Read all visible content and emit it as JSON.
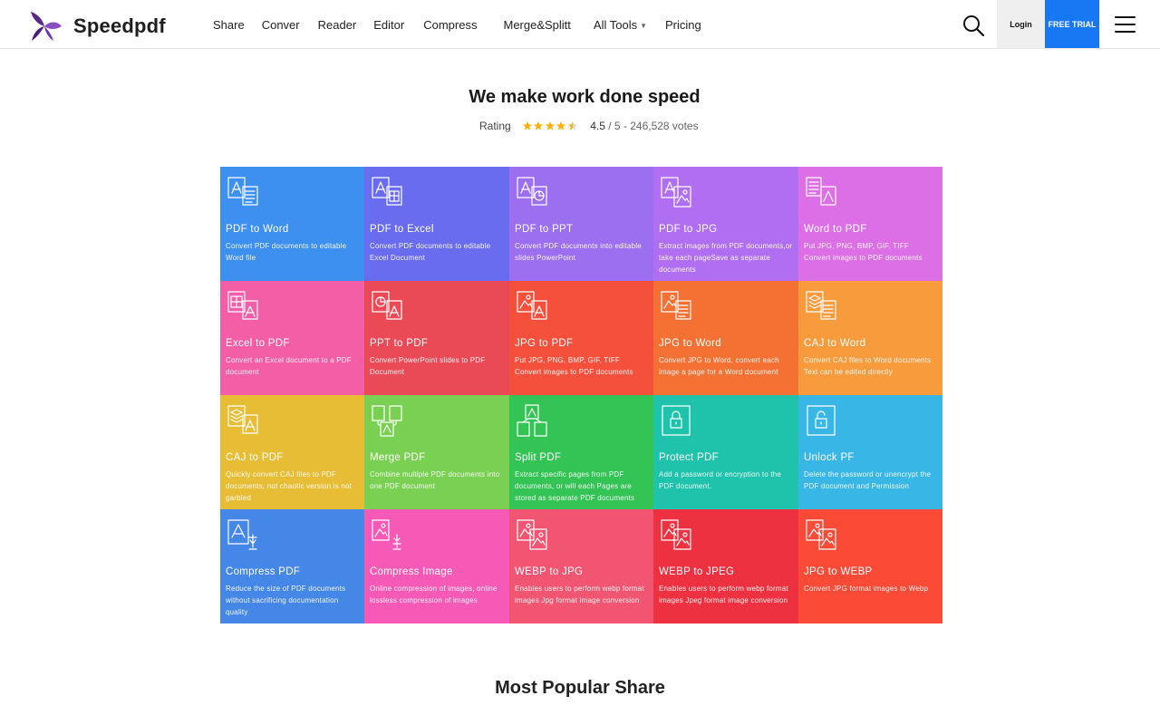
{
  "brand": {
    "name": "Speedpdf"
  },
  "nav": {
    "items": [
      "Share",
      "Conver",
      "Reader",
      "Editor",
      "Compress",
      "Merge&Splitt",
      "All Tools",
      "Pricing"
    ]
  },
  "header": {
    "login_label": "Login",
    "trial_label": "FREE TRIAL"
  },
  "hero": {
    "title": "We make work done speed",
    "rating_label": "Rating",
    "rating_score": "4.5",
    "rating_rest": " / 5 - 246,528 votes",
    "stars": 4.5
  },
  "tools": [
    {
      "title": "PDF to Word",
      "desc": "Convert PDF documents to editable Word file",
      "color": "#3d8ff0"
    },
    {
      "title": "PDF to Excel",
      "desc": "Convert PDF documents to editable Excel Document",
      "color": "#6a6cf0"
    },
    {
      "title": "PDF to PPT",
      "desc": "Convert PDF documents into editable slides PowerPoint",
      "color": "#9c6ff0"
    },
    {
      "title": "PDF to JPG",
      "desc": "Extract images from PDF documents,or take each pageSave as separate  documents",
      "color": "#b06ef2"
    },
    {
      "title": "Word to PDF",
      "desc": "Put JPG, PNG, BMP, GIF, TIFF Convert images to PDF documents",
      "color": "#dc6ee6"
    },
    {
      "title": "Excel to PDF",
      "desc": "Convert an Excel document to a PDF document",
      "color": "#f35ea6"
    },
    {
      "title": "PPT to PDF",
      "desc": "Convert PowerPoint slides to PDF Document",
      "color": "#ea4a56"
    },
    {
      "title": "JPG to PDF",
      "desc": "Put JPG, PNG, BMP, GIF, TIFF Convert images to PDF documents",
      "color": "#f4503c"
    },
    {
      "title": "JPG to Word",
      "desc": "Convert JPG to Word, convert each image a page for a Word document",
      "color": "#f57133"
    },
    {
      "title": "CAJ to Word",
      "desc": "Convert CAJ files to Word documents Text can be edited directly",
      "color": "#f79b3c"
    },
    {
      "title": "CAJ to PDF",
      "desc": "Quickly convert CAJ files to PDF documents, not chaotic version is not garbled",
      "color": "#e8bd36"
    },
    {
      "title": "Merge PDF",
      "desc": "Combine multiple PDF documents into one PDF document",
      "color": "#79d052"
    },
    {
      "title": "Split PDF",
      "desc": "Extract specific pages from PDF documents, or will each Pages are stored as separate PDF documents",
      "color": "#34c455"
    },
    {
      "title": "Protect PDF",
      "desc": "Add a password or encryption to the PDF document.",
      "color": "#1fc3ab"
    },
    {
      "title": "Unlock PF",
      "desc": "Delete the password or unencrypt the PDF document and Permission",
      "color": "#38b6e6"
    },
    {
      "title": "Compress PDF",
      "desc": "Reduce the size of PDF documents without sacrificing documentation quality",
      "color": "#4487e6"
    },
    {
      "title": "Compress Image",
      "desc": "Online compression of images, online lossless compression of images",
      "color": "#f75ab6"
    },
    {
      "title": "WEBP to JPG",
      "desc": "Enables users to perform webp format images  Jpg format image conversion",
      "color": "#f25571"
    },
    {
      "title": "WEBP to JPEG",
      "desc": "Enables users to perform webp format images Jpeg format image conversion",
      "color": "#ee3140"
    },
    {
      "title": "JPG to WEBP",
      "desc": "Convert JPG format images to Webp",
      "color": "#fb4a36"
    }
  ],
  "icons": [
    "pdf-word-icon",
    "pdf-excel-icon",
    "pdf-ppt-icon",
    "pdf-jpg-icon",
    "word-pdf-icon",
    "excel-pdf-icon",
    "ppt-pdf-icon",
    "jpg-pdf-icon",
    "jpg-word-icon",
    "caj-word-icon",
    "caj-pdf-icon",
    "merge-pdf-icon",
    "split-pdf-icon",
    "lock-icon",
    "unlock-icon",
    "compress-pdf-icon",
    "compress-image-icon",
    "webp-jpg-icon",
    "webp-jpeg-icon",
    "jpg-webp-icon"
  ],
  "section": {
    "title": "Most Popular Share"
  }
}
